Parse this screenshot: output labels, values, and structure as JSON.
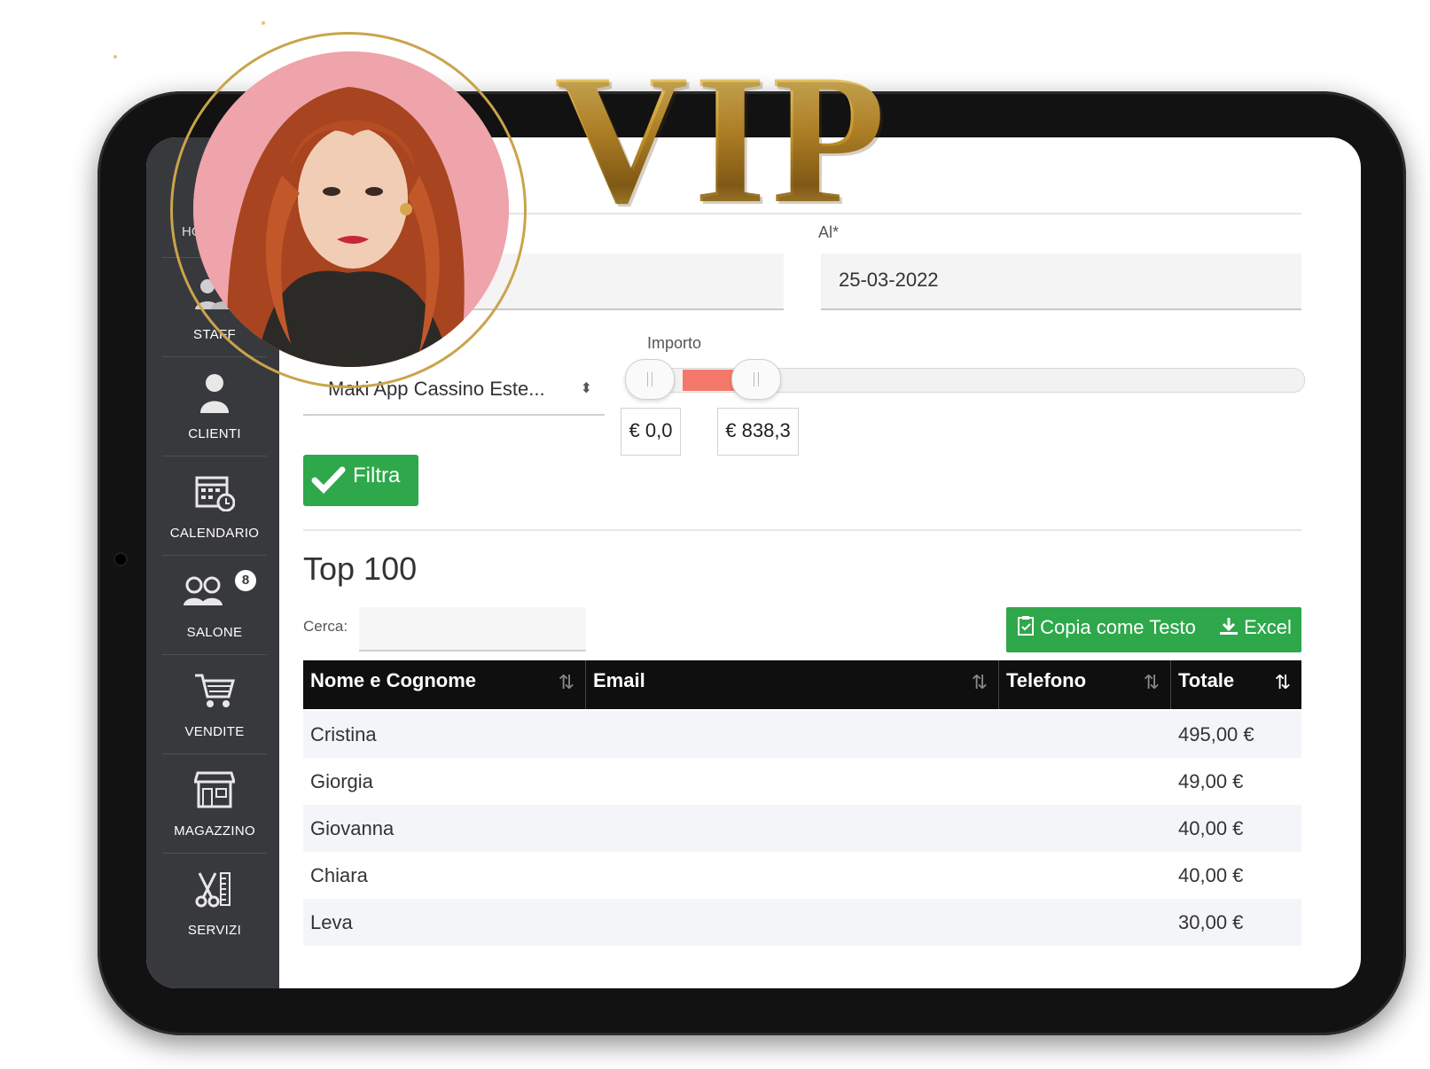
{
  "overlay": {
    "vip_text": "VIP"
  },
  "sidebar": {
    "items": [
      {
        "label": "STAFF",
        "icon": "staff-icon"
      },
      {
        "label": "CLIENTI",
        "icon": "client-icon"
      },
      {
        "label": "CALENDARIO",
        "icon": "calendar-icon"
      },
      {
        "label": "SALONE",
        "icon": "salon-icon",
        "badge": "8"
      },
      {
        "label": "VENDITE",
        "icon": "cart-icon"
      },
      {
        "label": "MAGAZZINO",
        "icon": "store-icon"
      },
      {
        "label": "SERVIZI",
        "icon": "scissors-icon"
      }
    ],
    "partial_label": "HO"
  },
  "filters": {
    "to_label": "Al*",
    "to_value": "25-03-2022",
    "store_select": "Maki App Cassino Este...",
    "amount_label": "Importo",
    "amount_min": "€ 0,0",
    "amount_max": "€ 838,3",
    "filter_button": "Filtra"
  },
  "results": {
    "title": "Top 100",
    "search_label": "Cerca:",
    "search_value": "",
    "copy_button": "Copia come Testo",
    "excel_button": "Excel",
    "columns": [
      "Nome e Cognome",
      "Email",
      "Telefono",
      "Totale"
    ],
    "rows": [
      {
        "name": "Cristina",
        "email": "",
        "phone": "",
        "total": "495,00 €"
      },
      {
        "name": "Giorgia",
        "email": "",
        "phone": "",
        "total": "49,00 €"
      },
      {
        "name": "Giovanna",
        "email": "",
        "phone": "",
        "total": "40,00 €"
      },
      {
        "name": "Chiara",
        "email": "",
        "phone": "",
        "total": "40,00 €"
      },
      {
        "name": "Leva",
        "email": "",
        "phone": "",
        "total": "30,00 €"
      }
    ]
  },
  "colors": {
    "accent_green": "#2ea84a",
    "range_fill": "#f4796b",
    "sidebar_bg": "#38393d",
    "gold": "#c9962e"
  }
}
